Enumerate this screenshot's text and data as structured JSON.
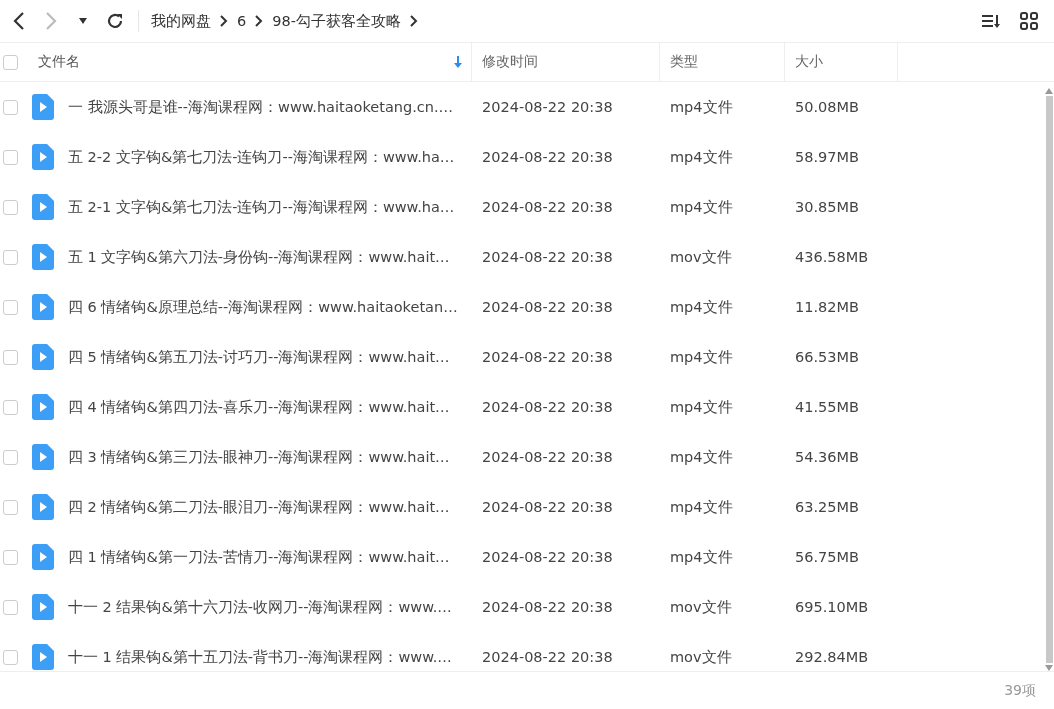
{
  "breadcrumb": [
    "我的网盘",
    "6",
    "98-勾子获客全攻略"
  ],
  "table": {
    "select_all": {
      "checked": false
    },
    "columns": [
      {
        "label": "文件名",
        "sorted": true
      },
      {
        "label": "修改时间",
        "sorted": false
      },
      {
        "label": "类型",
        "sorted": false
      },
      {
        "label": "大小",
        "sorted": false
      }
    ],
    "rows": [
      {
        "selected": false,
        "name": "一 我源头哥是谁--海淘课程网：www.haitaoketang.cn.…",
        "modified": "2024-08-22 20:38",
        "type": "mp4文件",
        "size": "50.08MB"
      },
      {
        "selected": false,
        "name": "五 2-2 文字钩&第七刀法-连钩刀--海淘课程网：www.ha…",
        "modified": "2024-08-22 20:38",
        "type": "mp4文件",
        "size": "58.97MB"
      },
      {
        "selected": false,
        "name": "五 2-1 文字钩&第七刀法-连钩刀--海淘课程网：www.ha…",
        "modified": "2024-08-22 20:38",
        "type": "mp4文件",
        "size": "30.85MB"
      },
      {
        "selected": false,
        "name": "五 1 文字钩&第六刀法-身份钩--海淘课程网：www.hait…",
        "modified": "2024-08-22 20:38",
        "type": "mov文件",
        "size": "436.58MB"
      },
      {
        "selected": false,
        "name": "四 6 情绪钩&原理总结--海淘课程网：www.haitaoketan…",
        "modified": "2024-08-22 20:38",
        "type": "mp4文件",
        "size": "11.82MB"
      },
      {
        "selected": false,
        "name": "四 5 情绪钩&第五刀法-讨巧刀--海淘课程网：www.hait…",
        "modified": "2024-08-22 20:38",
        "type": "mp4文件",
        "size": "66.53MB"
      },
      {
        "selected": false,
        "name": "四 4 情绪钩&第四刀法-喜乐刀--海淘课程网：www.hait…",
        "modified": "2024-08-22 20:38",
        "type": "mp4文件",
        "size": "41.55MB"
      },
      {
        "selected": false,
        "name": "四 3 情绪钩&第三刀法-眼神刀--海淘课程网：www.hait…",
        "modified": "2024-08-22 20:38",
        "type": "mp4文件",
        "size": "54.36MB"
      },
      {
        "selected": false,
        "name": "四 2 情绪钩&第二刀法-眼泪刀--海淘课程网：www.hait…",
        "modified": "2024-08-22 20:38",
        "type": "mp4文件",
        "size": "63.25MB"
      },
      {
        "selected": false,
        "name": "四 1 情绪钩&第一刀法-苦情刀--海淘课程网：www.hait…",
        "modified": "2024-08-22 20:38",
        "type": "mp4文件",
        "size": "56.75MB"
      },
      {
        "selected": false,
        "name": "十一 2 结果钩&第十六刀法-收网刀--海淘课程网：www.…",
        "modified": "2024-08-22 20:38",
        "type": "mov文件",
        "size": "695.10MB"
      },
      {
        "selected": false,
        "name": "十一 1 结果钩&第十五刀法-背书刀--海淘课程网：www.…",
        "modified": "2024-08-22 20:38",
        "type": "mov文件",
        "size": "292.84MB"
      }
    ]
  },
  "status_bar": {
    "count": "39项"
  }
}
